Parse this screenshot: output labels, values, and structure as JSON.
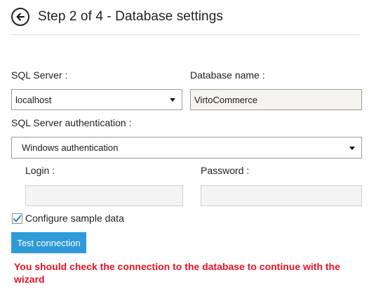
{
  "header": {
    "back_icon": "back-arrow-icon",
    "title": "Step 2 of 4 - Database settings"
  },
  "form": {
    "sql_server_label": "SQL Server :",
    "sql_server_value": "localhost",
    "database_name_label": "Database name :",
    "database_name_value": "VirtoCommerce",
    "auth_label": "SQL Server authentication :",
    "auth_value": "Windows authentication",
    "login_label": "Login :",
    "login_value": "",
    "password_label": "Password :",
    "password_value": "",
    "sample_data_label": "Configure sample data",
    "sample_data_checked": true
  },
  "actions": {
    "test_connection_label": "Test connection"
  },
  "messages": {
    "connection_warning": "You should check the connection to the database to continue with the wizard"
  },
  "colors": {
    "accent": "#2e9ad8",
    "error": "#e81123",
    "readonly_field": "#f5f4ee"
  }
}
